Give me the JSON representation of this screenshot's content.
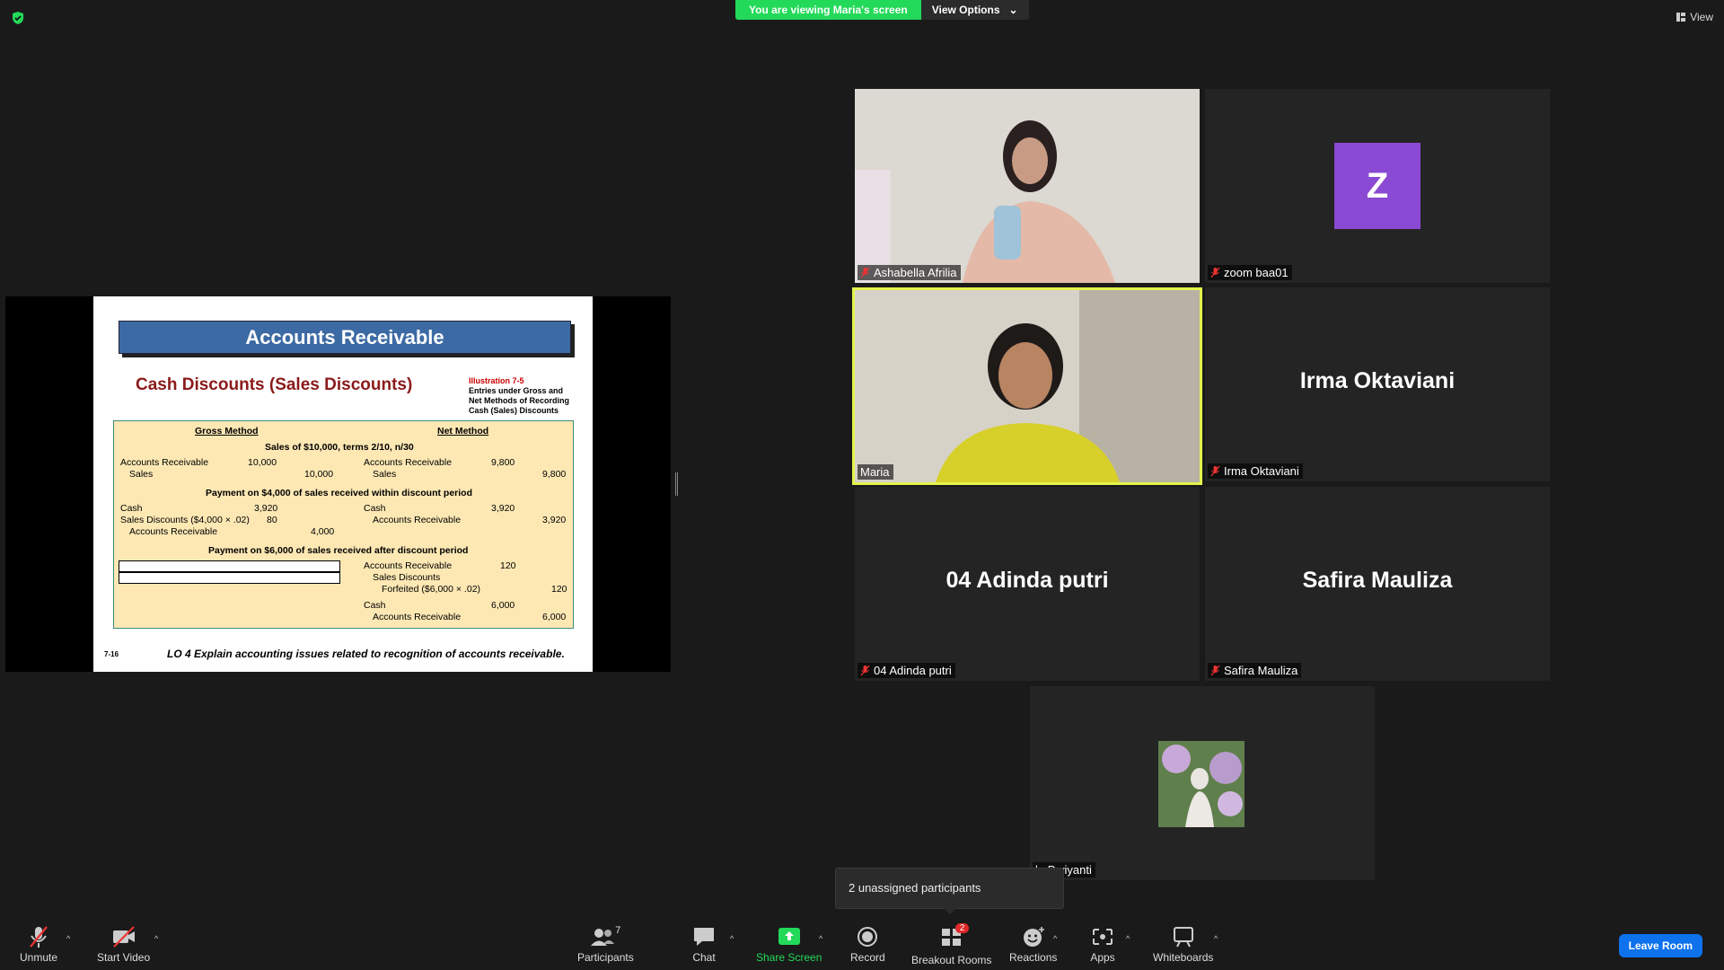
{
  "banner": {
    "viewing_text": "You are viewing Maria's screen",
    "view_options_label": "View Options"
  },
  "view_button": {
    "label": "View"
  },
  "slide": {
    "header": "Accounts Receivable",
    "subtitle": "Cash Discounts (Sales Discounts)",
    "illustration_number": "Illustration 7-5",
    "illustration_caption": [
      "Entries under Gross and",
      "Net Methods of Recording",
      "Cash (Sales) Discounts"
    ],
    "col_gross": "Gross Method",
    "col_net": "Net Method",
    "sec1": "Sales of $10,000, terms 2/10, n/30",
    "sec2": "Payment on $4,000 of sales received within discount period",
    "sec3": "Payment on $6,000 of sales received after discount period",
    "rows": {
      "ar": "Accounts Receivable",
      "sales": "Sales",
      "cash": "Cash",
      "sales_disc_gross": "Sales Discounts ($4,000 × .02)",
      "sales_discounts": "Sales Discounts",
      "forfeited": "Forfeited ($6,000 × .02)",
      "v10000": "10,000",
      "v9800": "9,800",
      "v3920": "3,920",
      "v80": "80",
      "v4000": "4,000",
      "v120": "120",
      "v6000": "6,000"
    },
    "footer_num": "7-16",
    "footer_lo": "LO 4  Explain accounting issues related to recognition of accounts receivable."
  },
  "participants": [
    {
      "name": "Ashabella Afrilia",
      "muted": true
    },
    {
      "name": "zoom baa01",
      "muted": true,
      "avatar_letter": "Z"
    },
    {
      "name": "Maria",
      "muted": false,
      "speaking": true
    },
    {
      "name": "Irma Oktaviani",
      "muted": true
    },
    {
      "name": "04 Adinda putri",
      "muted": true
    },
    {
      "name": "Safira Mauliza",
      "muted": true
    },
    {
      "name": "la Dwiyanti",
      "muted": false
    }
  ],
  "tooltip": {
    "text": "2 unassigned participants"
  },
  "toolbar": {
    "unmute": "Unmute",
    "start_video": "Start Video",
    "participants": "Participants",
    "participants_count": "7",
    "chat": "Chat",
    "share_screen": "Share Screen",
    "record": "Record",
    "breakout_rooms": "Breakout Rooms",
    "breakout_badge": "2",
    "reactions": "Reactions",
    "apps": "Apps",
    "whiteboards": "Whiteboards",
    "leave": "Leave Room"
  },
  "colors": {
    "accent_green": "#23d959",
    "active_speaker_border": "#e4f34c",
    "leave_blue": "#0e72ed",
    "badge_red": "#e02828"
  }
}
